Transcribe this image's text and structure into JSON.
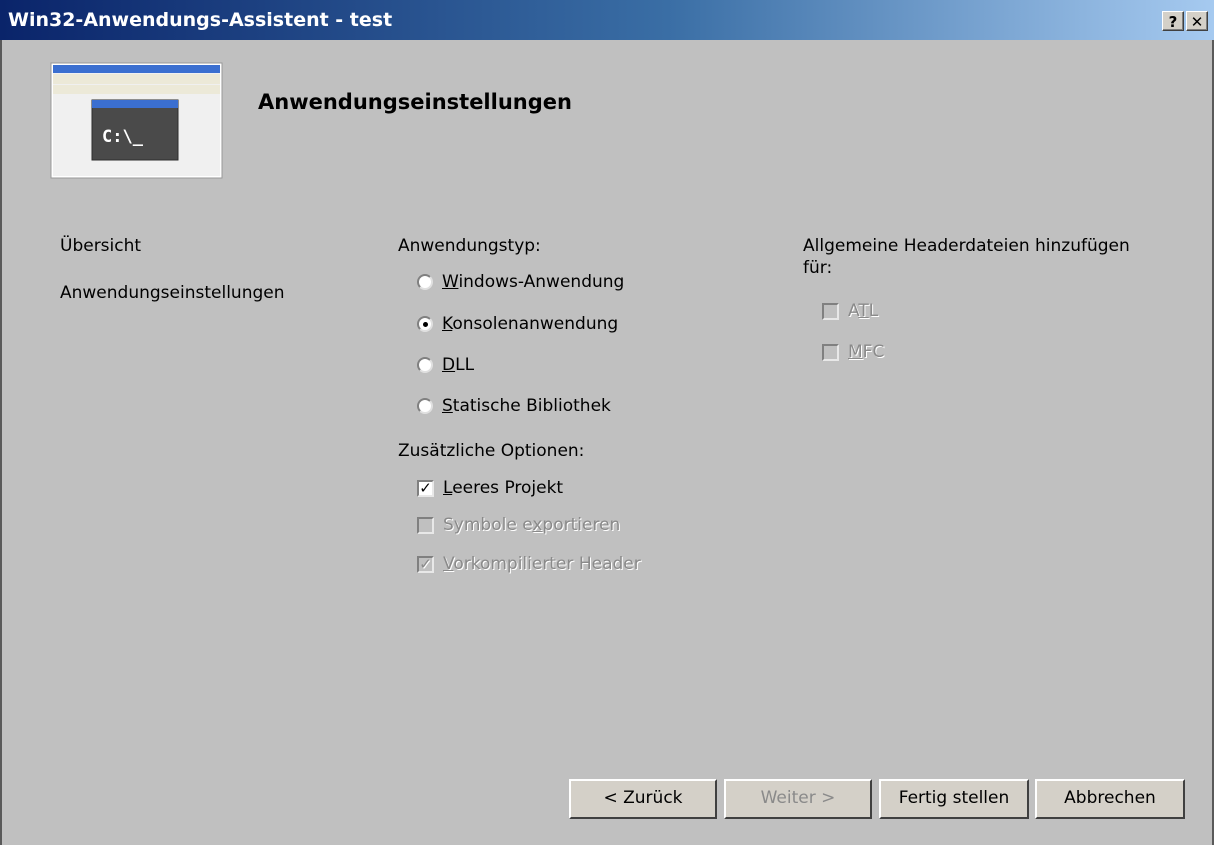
{
  "window": {
    "title": "Win32-Anwendungs-Assistent - test",
    "help_label": "?",
    "close_label": "✕"
  },
  "banner": {
    "title": "Anwendungseinstellungen",
    "icon_text": "C:\\_"
  },
  "nav": {
    "items": [
      "Übersicht",
      "Anwendungseinstellungen"
    ]
  },
  "app_type": {
    "heading": "Anwendungstyp:",
    "options": [
      {
        "accel": "W",
        "rest": "indows-Anwendung",
        "checked": false
      },
      {
        "accel": "K",
        "rest": "onsolenanwendung",
        "checked": true
      },
      {
        "accel": "D",
        "rest": "LL",
        "checked": false
      },
      {
        "accel": "S",
        "rest": "tatische Bibliothek",
        "checked": false
      }
    ]
  },
  "additional": {
    "heading": "Zusätzliche Optionen:",
    "options": [
      {
        "pre": "",
        "accel": "L",
        "rest": "eeres Projekt",
        "checked": true,
        "enabled": true
      },
      {
        "pre": "Symbole e",
        "accel": "x",
        "rest": "portieren",
        "checked": false,
        "enabled": false
      },
      {
        "pre": "",
        "accel": "V",
        "rest": "orkompilierter Header",
        "checked": true,
        "enabled": false
      }
    ]
  },
  "headers": {
    "heading_line1": "Allgemeine Headerdateien hinzufügen",
    "heading_line2": "für:",
    "options": [
      {
        "pre": "A",
        "accel": "T",
        "rest": "L"
      },
      {
        "pre": "",
        "accel": "M",
        "rest": "FC"
      }
    ]
  },
  "buttons": {
    "back": "< Zurück",
    "next": "Weiter >",
    "finish": "Fertig stellen",
    "cancel": "Abbrechen"
  }
}
